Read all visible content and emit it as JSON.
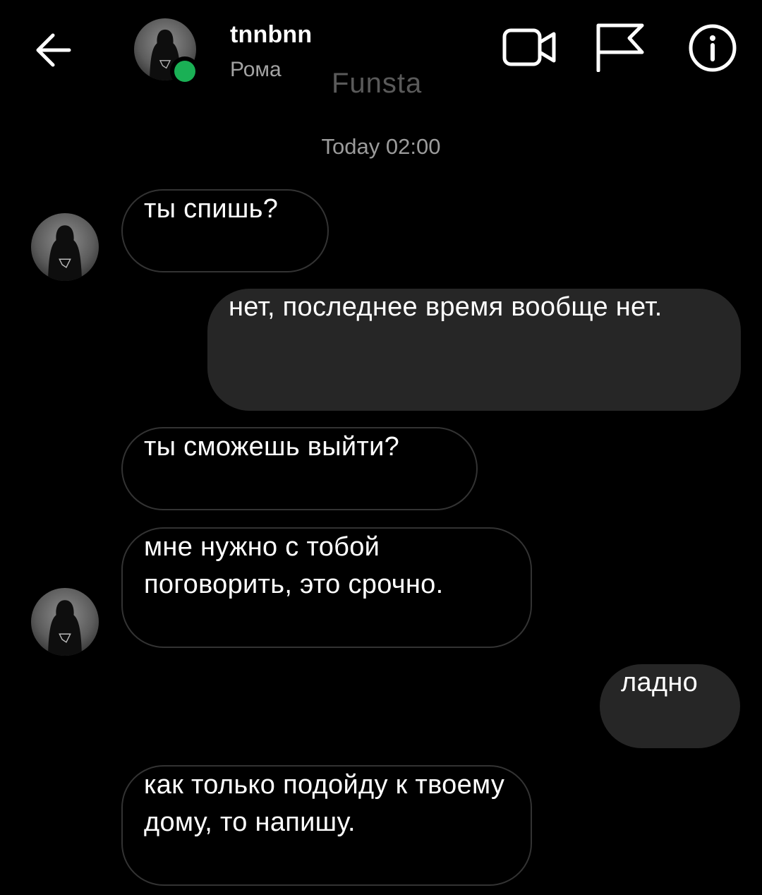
{
  "header": {
    "username": "tnnbnn",
    "subname": "Рома",
    "back_icon": "arrow-left-icon",
    "video_icon": "video-camera-icon",
    "flag_icon": "flag-icon",
    "info_icon": "info-icon",
    "online_color": "#1ab055"
  },
  "watermark": "Funsta",
  "chat": {
    "timestamp": "Today 02:00",
    "messages": [
      {
        "direction": "incoming",
        "text": "ты спишь?"
      },
      {
        "direction": "outgoing",
        "text": "нет, последнее время вообще нет."
      },
      {
        "direction": "incoming",
        "text": "ты сможешь выйти?"
      },
      {
        "direction": "incoming",
        "text": "мне нужно с тобой поговорить, это срочно."
      },
      {
        "direction": "outgoing",
        "text": "ладно"
      },
      {
        "direction": "incoming",
        "text": "как только подойду к твоему дому, то напишу."
      }
    ]
  },
  "colors": {
    "background": "#000000",
    "outgoing_bubble": "#262626",
    "incoming_border": "#333333",
    "secondary_text": "#9b9b9b"
  }
}
